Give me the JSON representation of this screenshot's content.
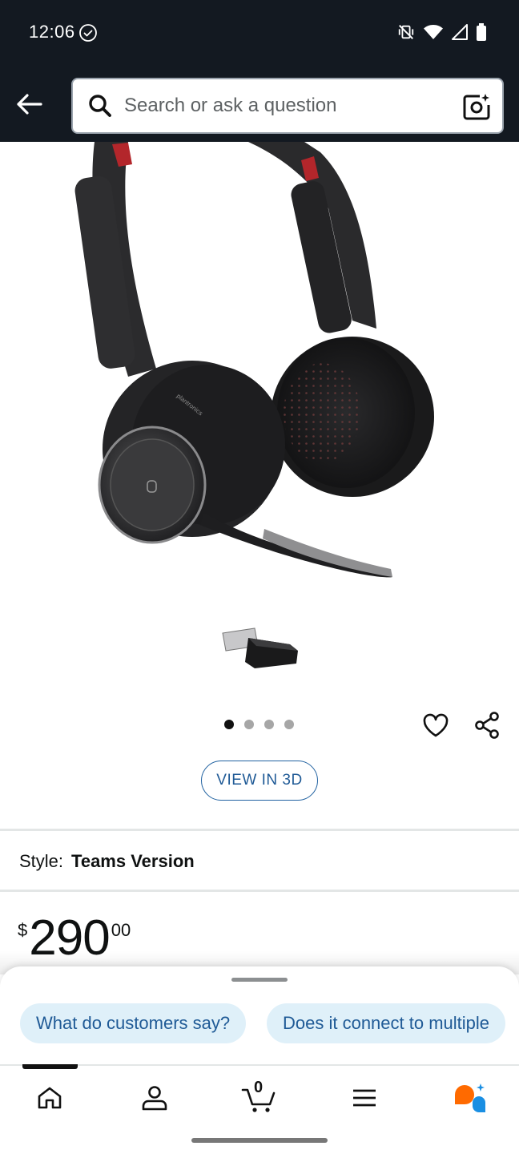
{
  "status_bar": {
    "time": "12:06"
  },
  "header": {
    "search": {
      "placeholder": "Search or ask a question"
    },
    "icons": [
      "back-arrow-icon",
      "search-icon",
      "camera-search-icon"
    ]
  },
  "product": {
    "image_carousel": {
      "total_images": 4,
      "active_index": 0
    },
    "view_3d_label": "VIEW IN 3D",
    "headset_brand_print": "plantronics",
    "style": {
      "label": "Style:",
      "value": "Teams Version"
    },
    "price": {
      "symbol": "$",
      "whole": "290",
      "fraction": "00"
    }
  },
  "suggestions": {
    "chips": [
      "What do customers say?",
      "Does it connect to multiple"
    ]
  },
  "bottom_nav": {
    "active": "home",
    "cart_count": "0",
    "items": [
      "home-icon",
      "account-icon",
      "cart-icon",
      "menu-icon",
      "rufus-assistant-icon"
    ]
  },
  "colors": {
    "header_bg": "#131921",
    "link_blue": "#1f5a96",
    "chip_bg": "#dff0f9",
    "assistant_orange": "#ff6a00",
    "assistant_blue": "#1a8fe3"
  }
}
